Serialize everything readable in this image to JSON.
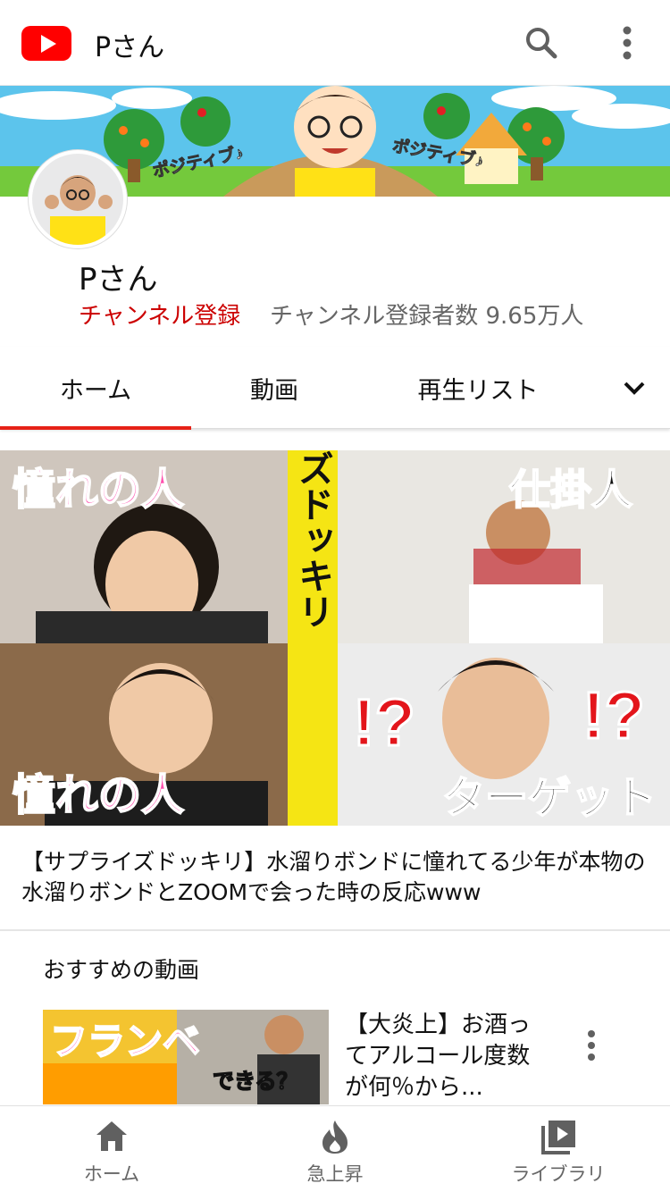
{
  "colors": {
    "brand_red": "#ff0000",
    "subscribe_red": "#cc0000",
    "tab_indicator": "#e62117"
  },
  "appbar": {
    "title": "Pさん",
    "logo_icon": "youtube-logo",
    "search_icon": "search-icon",
    "more_icon": "more-vert-icon"
  },
  "channel": {
    "name": "Pさん",
    "subscribe_label": "チャンネル登録",
    "subscriber_count": "チャンネル登録者数 9.65万人",
    "banner_text_left": "ポジティブ♪",
    "banner_text_right": "ポジティブ♪"
  },
  "tabs": [
    {
      "label": "ホーム",
      "selected": true
    },
    {
      "label": "動画",
      "selected": false
    },
    {
      "label": "再生リスト",
      "selected": false
    }
  ],
  "featured": {
    "title": "【サプライズドッキリ】水溜りボンドに憧れてる少年が本物の水溜りボンドとZOOMで会った時の反応www",
    "thumb_texts": {
      "top_left": "憧れの人",
      "top_right": "仕掛人",
      "bottom_left": "憧れの人",
      "bottom_right": "ターゲット",
      "center_vertical": "サプライズドッキリ",
      "marks": "!?",
      "marks_right": "!?"
    }
  },
  "recommended": {
    "section_title": "おすすめの動画",
    "items": [
      {
        "title": "【大炎上】お酒ってアルコール度数が何％から...",
        "thumb_text_main": "フランベ",
        "thumb_text_sub": "できる？"
      }
    ]
  },
  "bottom_nav": [
    {
      "label": "ホーム",
      "icon": "home-icon"
    },
    {
      "label": "急上昇",
      "icon": "flame-icon"
    },
    {
      "label": "ライブラリ",
      "icon": "library-icon"
    }
  ]
}
